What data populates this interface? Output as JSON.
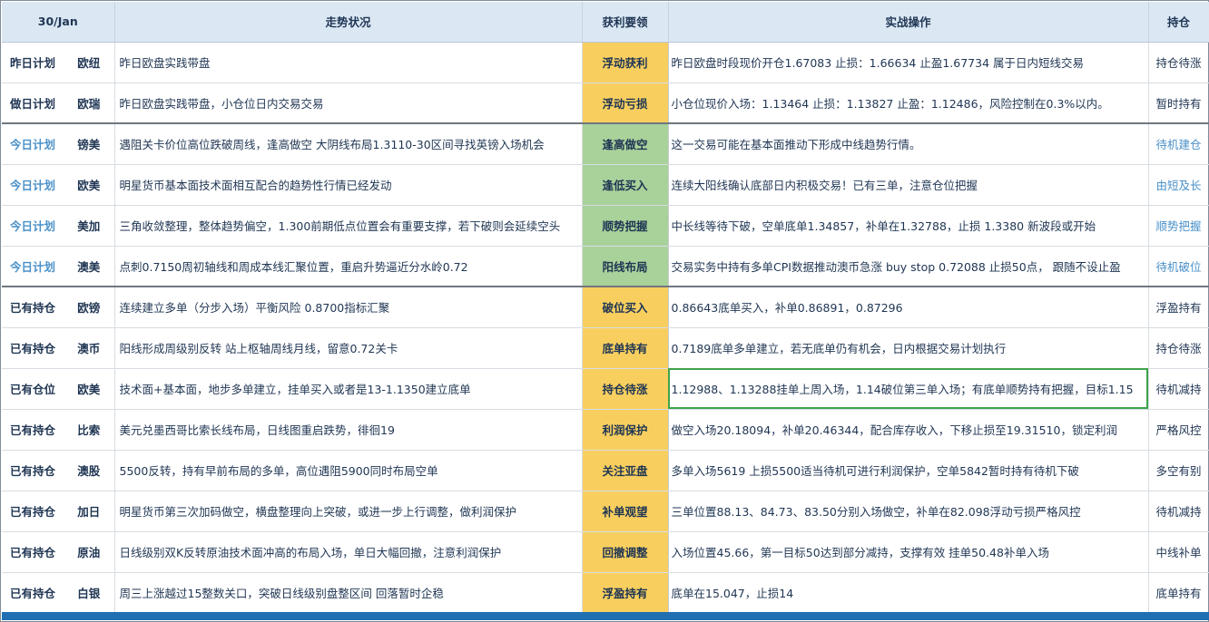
{
  "header": {
    "date": "30/Jan",
    "trend": "走势状况",
    "key": "获利要领",
    "action": "实战操作",
    "position": "持仓"
  },
  "rows": [
    {
      "plan": "昨日计划",
      "symbol": "欧纽",
      "trend": "昨日欧盘实践带盘",
      "key": "浮动获利",
      "key_color": "yellow",
      "action": "昨日欧盘时段现价开仓1.67083 止损：1.66634  止盈1.67734 属于日内短线交易",
      "position": "持仓待涨",
      "style": "bold"
    },
    {
      "plan": "做日计划",
      "symbol": "欧瑞",
      "trend": "昨日欧盘实践带盘，小仓位日内交易交易",
      "key": "浮动亏损",
      "key_color": "yellow",
      "action": "小仓位现价入场：1.13464  止损：1.13827  止盈：1.12486，风险控制在0.3%以内。",
      "position": "暂时持有",
      "style": "bold"
    },
    {
      "plan": "今日计划",
      "symbol": "镑美",
      "trend": "遇阻关卡价位高位跌破周线，逢高做空  大阴线布局1.3110-30区间寻找英镑入场机会",
      "key": "逢高做空",
      "key_color": "green",
      "action": "这一交易可能在基本面推动下形成中线趋势行情。",
      "position": "待机建仓",
      "style": "today"
    },
    {
      "plan": "今日计划",
      "symbol": "欧美",
      "trend": "明星货币基本面技术面相互配合的趋势性行情已经发动",
      "key": "逢低买入",
      "key_color": "green",
      "action": "连续大阳线确认底部日内积极交易！已有三单，注意仓位把握",
      "position": "由短及长",
      "style": "today"
    },
    {
      "plan": "今日计划",
      "symbol": "美加",
      "trend": "三角收敛整理，整体趋势偏空，1.300前期低点位置会有重要支撑，若下破则会延续空头",
      "key": "顺势把握",
      "key_color": "green",
      "action": "中长线等待下破，空单底单1.34857，补单在1.32788，止损 1.3380  新波段或开始",
      "position": "顺势把握",
      "style": "today"
    },
    {
      "plan": "今日计划",
      "symbol": "澳美",
      "trend": "点刺0.7150周初轴线和周成本线汇聚位置，重启升势逼近分水岭0.72",
      "key": "阳线布局",
      "key_color": "green",
      "action": "交易实务中持有多单CPI数据推动澳币急涨 buy stop 0.72088 止损50点， 跟随不设止盈",
      "position": "待机破位",
      "style": "today"
    },
    {
      "plan": "已有持仓",
      "symbol": "欧镑",
      "trend": "连续建立多单（分步入场）平衡风险   0.8700指标汇聚",
      "key": "破位买入",
      "key_color": "yellow",
      "action": "0.86643底单买入，补单0.86891，0.87296",
      "position": "浮盈持有",
      "style": "bold"
    },
    {
      "plan": "已有持仓",
      "symbol": "澳币",
      "trend": "阳线形成周级别反转 站上枢轴周线月线，留意0.72关卡",
      "key": "底单持有",
      "key_color": "yellow",
      "action": "0.7189底单多单建立，若无底单仍有机会，日内根据交易计划执行",
      "position": "持仓待涨",
      "style": "bold"
    },
    {
      "plan": "已有仓位",
      "symbol": "欧美",
      "trend": "技术面+基本面，地步多单建立，挂单买入或者是13-1.1350建立底单",
      "key": "持仓待涨",
      "key_color": "yellow",
      "action": "1.12988、1.13288挂单上周入场，1.14破位第三单入场；有底单顺势持有把握，目标1.15",
      "position": "待机减持",
      "style": "bold"
    },
    {
      "plan": "已有持仓",
      "symbol": "比索",
      "trend": "美元兑墨西哥比索长线布局，日线图重启跌势，徘徊19",
      "key": "利润保护",
      "key_color": "yellow",
      "action": "做空入场20.18094，补单20.46344，配合库存收入，下移止损至19.31510，锁定利润",
      "position": "严格风控",
      "style": "bold"
    },
    {
      "plan": "已有持仓",
      "symbol": "澳股",
      "trend": "5500反转，持有早前布局的多单，高位遇阻5900同时布局空单",
      "key": "关注亚盘",
      "key_color": "yellow",
      "action": "多单入场5619 上损5500适当待机可进行利润保护，空单5842暂时持有待机下破",
      "position": "多空有别",
      "style": "bold"
    },
    {
      "plan": "已有持仓",
      "symbol": "加日",
      "trend": "明星货币第三次加码做空，横盘整理向上突破，或进一步上行调整，做利润保护",
      "key": "补单观望",
      "key_color": "yellow",
      "action": "三单位置88.13、84.73、83.50分别入场做空，补单在82.098浮动亏损严格风控",
      "position": "待机减持",
      "style": "bold"
    },
    {
      "plan": "已有持仓",
      "symbol": "原油",
      "trend": "日线级别双K反转原油技术面冲高的布局入场，单日大幅回撤，注意利润保护",
      "key": "回撤调整",
      "key_color": "yellow",
      "action": "入场位置45.66，第一目标50达到部分减持，支撑有效 挂单50.48补单入场",
      "position": "中线补单",
      "style": "bold"
    },
    {
      "plan": "已有持仓",
      "symbol": "白银",
      "trend": "周三上涨越过15整数关口，突破日线级别盘整区间 回落暂时企稳",
      "key": "浮盈持有",
      "key_color": "yellow",
      "action": "底单在15.047，止损14",
      "position": "底单持有",
      "style": "bold"
    }
  ]
}
